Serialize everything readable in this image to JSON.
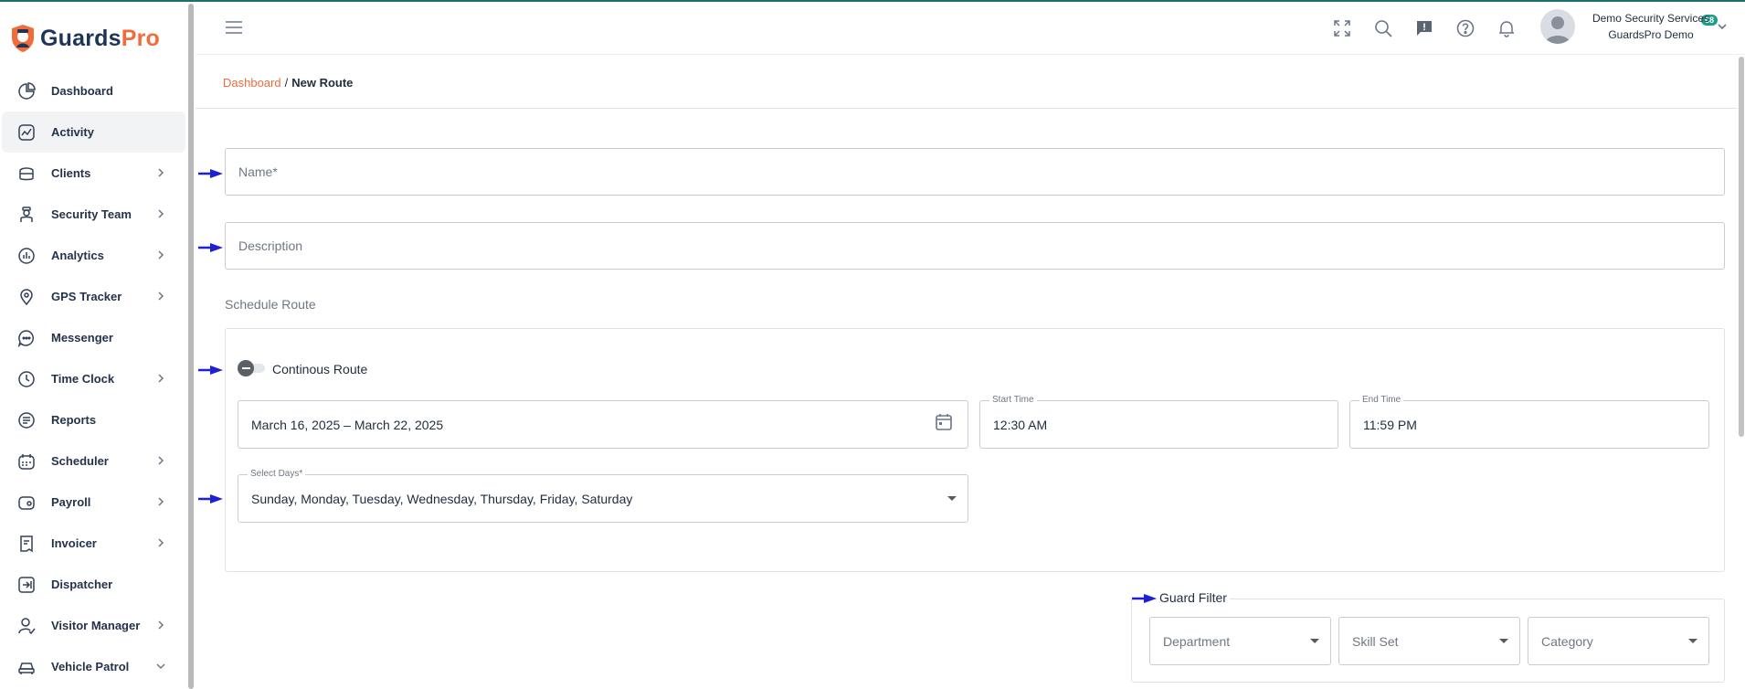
{
  "brand": {
    "part1": "Guards",
    "part2": "Pro"
  },
  "sidebar": {
    "items": [
      {
        "label": "Dashboard",
        "icon": "dashboard-icon",
        "chevron": ""
      },
      {
        "label": "Activity",
        "icon": "activity-icon",
        "chevron": "",
        "active": true
      },
      {
        "label": "Clients",
        "icon": "briefcase-icon",
        "chevron": "right"
      },
      {
        "label": "Security Team",
        "icon": "guard-icon",
        "chevron": "right"
      },
      {
        "label": "Analytics",
        "icon": "analytics-icon",
        "chevron": "right"
      },
      {
        "label": "GPS Tracker",
        "icon": "map-pin-icon",
        "chevron": "right"
      },
      {
        "label": "Messenger",
        "icon": "chat-icon",
        "chevron": ""
      },
      {
        "label": "Time Clock",
        "icon": "clock-icon",
        "chevron": "right"
      },
      {
        "label": "Reports",
        "icon": "reports-icon",
        "chevron": ""
      },
      {
        "label": "Scheduler",
        "icon": "calendar-icon",
        "chevron": "right"
      },
      {
        "label": "Payroll",
        "icon": "wallet-icon",
        "chevron": "right"
      },
      {
        "label": "Invoicer",
        "icon": "invoice-icon",
        "chevron": "right"
      },
      {
        "label": "Dispatcher",
        "icon": "dispatch-icon",
        "chevron": ""
      },
      {
        "label": "Visitor Manager",
        "icon": "visitor-icon",
        "chevron": "right"
      },
      {
        "label": "Vehicle Patrol",
        "icon": "car-icon",
        "chevron": "down"
      }
    ]
  },
  "header": {
    "notification_count": "68",
    "user_company": "Demo Security Services",
    "user_name": "GuardsPro Demo"
  },
  "breadcrumb": {
    "parent": "Dashboard",
    "separator": "/",
    "current": "New Route"
  },
  "form": {
    "name_placeholder": "Name*",
    "description_placeholder": "Description",
    "schedule_label": "Schedule Route",
    "continuous_label": "Continous Route",
    "continuous_on": false,
    "date_range": "March 16, 2025 – March 22, 2025",
    "start_time_label": "Start Time",
    "start_time": "12:30 AM",
    "end_time_label": "End Time",
    "end_time": "11:59 PM",
    "select_days_label": "Select Days*",
    "select_days_value": "Sunday, Monday, Tuesday, Wednesday, Thursday, Friday, Saturday"
  },
  "guard_filter": {
    "title": "Guard Filter",
    "department_placeholder": "Department",
    "skillset_placeholder": "Skill Set",
    "category_placeholder": "Category"
  },
  "colors": {
    "accent": "#f26b3a",
    "brand_dark": "#1d3557",
    "badge": "#1e9d8b",
    "arrow": "#1f1fd6"
  }
}
